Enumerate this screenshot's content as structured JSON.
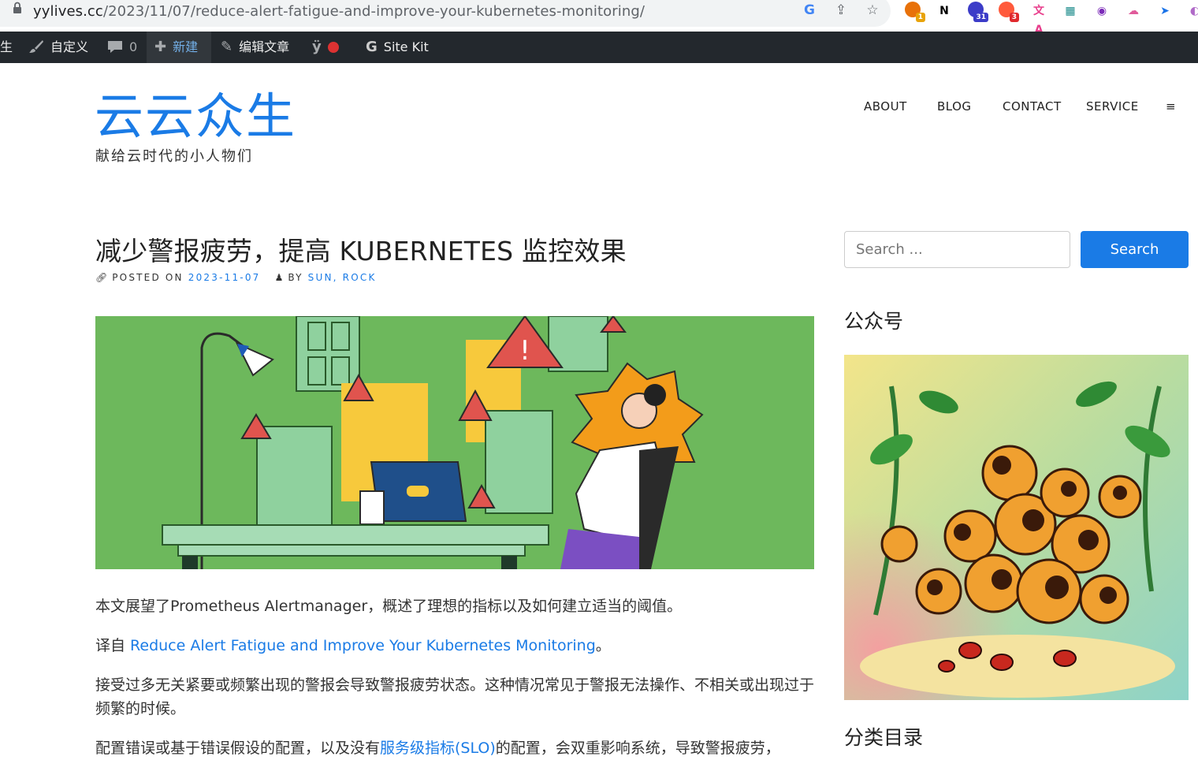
{
  "browser": {
    "url_host": "yylives.cc",
    "url_path": "/2023/11/07/reduce-alert-fatigue-and-improve-your-kubernetes-monitoring/",
    "extensions": [
      {
        "name": "multicolor-extension-icon",
        "badge": "1",
        "color": "#e8710a",
        "badge_color": "#e8a30a"
      },
      {
        "name": "notion-icon",
        "glyph": "N",
        "color": "#000000"
      },
      {
        "name": "graduate-cap-icon",
        "badge": "31",
        "color": "#3c3cc8",
        "badge_color": "#3c3cc8"
      },
      {
        "name": "chat-bubbles-icon",
        "badge": "3",
        "color": "#ff5a3c",
        "badge_color": "#e0292d"
      },
      {
        "name": "translate-icon",
        "glyph": "文A",
        "color": "#e83e8c"
      },
      {
        "name": "grid-extension-icon",
        "glyph": "▦",
        "color": "#1a8a8a"
      },
      {
        "name": "circle-extension-icon",
        "glyph": "◉",
        "color": "#7b2ab8"
      },
      {
        "name": "cloud-extension-icon",
        "glyph": "☁",
        "color": "#e05a9a"
      },
      {
        "name": "blue-arrow-icon",
        "glyph": "➤",
        "color": "#1a73e8"
      },
      {
        "name": "purple-swirl-icon",
        "glyph": "◐",
        "color": "#b06ac8"
      }
    ]
  },
  "adminbar": {
    "site_fragment": "生",
    "customize": "自定义",
    "comments_count": "0",
    "new": "新建",
    "edit_post": "编辑文章",
    "sitekit": "Site Kit"
  },
  "site": {
    "title": "云云众生",
    "tagline": "献给云时代的小人物们",
    "nav": [
      "ABOUT",
      "BLOG",
      "CONTACT",
      "SERVICE",
      "≡"
    ]
  },
  "post": {
    "title": "减少警报疲劳，提高 KUBERNETES 监控效果",
    "posted_on_label": "POSTED ON",
    "date": "2023-11-07",
    "by_label": "BY",
    "author": "SUN, ROCK",
    "para1": "本文展望了Prometheus Alertmanager，概述了理想的指标以及如何建立适当的阈值。",
    "para2_prefix": "译自 ",
    "para2_link": "Reduce Alert Fatigue and Improve Your Kubernetes Monitoring",
    "para2_suffix": "。",
    "para3": "接受过多无关紧要或频繁出现的警报会导致警报疲劳状态。这种情况常见于警报无法操作、不相关或出现过于频繁的时候。",
    "para4_prefix": "配置错误或基于错误假设的配置，以及没有",
    "para4_link": "服务级指标(SLO)",
    "para4_suffix": "的配置，会双重影响系统，导致警报疲劳，"
  },
  "sidebar": {
    "search_placeholder": "Search ...",
    "search_button": "Search",
    "widget1_title": "公众号",
    "widget2_title": "分类目录"
  },
  "colors": {
    "accent": "#1a7be6",
    "adminbar": "#23282d",
    "hero_bg": "#6db85c"
  }
}
